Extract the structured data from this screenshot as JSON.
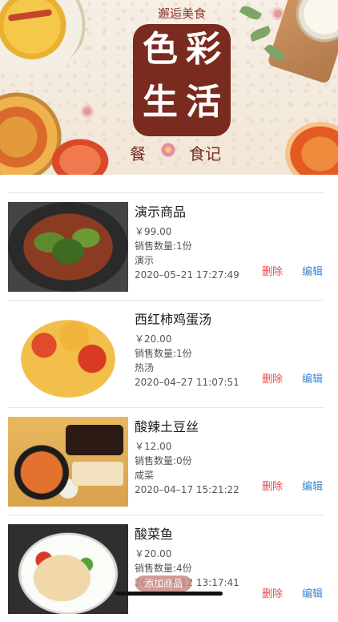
{
  "banner": {
    "top_text": "邂逅美食",
    "logo_chars": [
      "色",
      "彩",
      "生",
      "活"
    ],
    "bottom_left": "餐",
    "bottom_right": "食记"
  },
  "items": [
    {
      "name": "演示商品",
      "price": "￥99.00",
      "sales": "销售数量:1份",
      "category": "演示",
      "time": "2020–05–21 17:27:49",
      "delete_label": "删除",
      "edit_label": "编辑"
    },
    {
      "name": "西红柿鸡蛋汤",
      "price": "￥20.00",
      "sales": "销售数量:1份",
      "category": "热汤",
      "time": "2020–04–27 11:07:51",
      "delete_label": "删除",
      "edit_label": "编辑"
    },
    {
      "name": "酸辣土豆丝",
      "price": "￥12.00",
      "sales": "销售数量:0份",
      "category": "咸菜",
      "time": "2020–04–17 15:21:22",
      "delete_label": "删除",
      "edit_label": "编辑"
    },
    {
      "name": "酸菜鱼",
      "price": "￥20.00",
      "sales": "销售数量:4份",
      "category": "",
      "time": "2020–03–12 13:17:41",
      "delete_label": "删除",
      "edit_label": "编辑"
    }
  ],
  "overlay_button": "添加商品",
  "colors": {
    "delete": "#e54b4b",
    "edit": "#3a86d4",
    "logo_bg": "#7a2a1f"
  }
}
